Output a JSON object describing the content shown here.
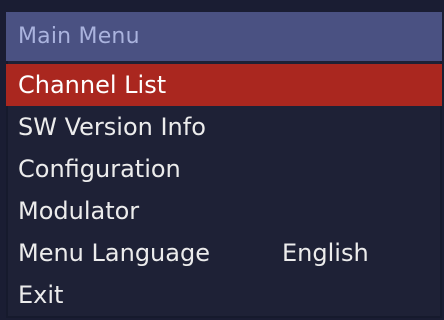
{
  "menu": {
    "title": "Main Menu",
    "items": [
      {
        "label": "Channel List",
        "value": "",
        "selected": true
      },
      {
        "label": "SW Version Info",
        "value": "",
        "selected": false
      },
      {
        "label": "Configuration",
        "value": "",
        "selected": false
      },
      {
        "label": "Modulator",
        "value": "",
        "selected": false
      },
      {
        "label": "Menu Language",
        "value": "English",
        "selected": false
      },
      {
        "label": "Exit",
        "value": "",
        "selected": false
      }
    ]
  },
  "colors": {
    "background": "#1a1d33",
    "title_bar": "#4a5182",
    "title_text": "#aab3de",
    "highlight": "#aa271f",
    "item_text": "#ececec"
  }
}
